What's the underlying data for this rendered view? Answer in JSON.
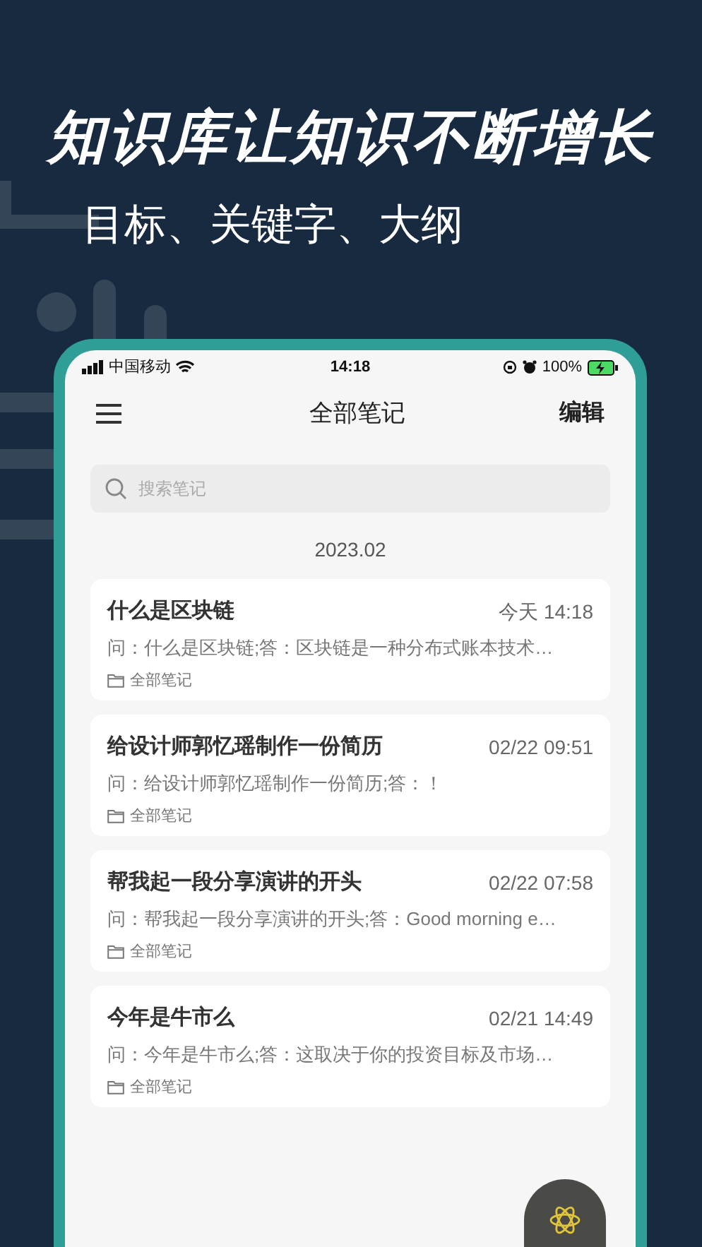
{
  "promo": {
    "headline": "知识库让知识不断增长",
    "subtitle": "目标、关键字、大纲"
  },
  "status_bar": {
    "carrier": "中国移动",
    "time": "14:18",
    "battery": "100%"
  },
  "nav": {
    "title": "全部笔记",
    "action": "编辑"
  },
  "search": {
    "placeholder": "搜索笔记"
  },
  "section_date": "2023.02",
  "notes": [
    {
      "title": "什么是区块链",
      "time": "今天 14:18",
      "preview": "问：什么是区块链;答：区块链是一种分布式账本技术…",
      "folder": "全部笔记"
    },
    {
      "title": "给设计师郭忆瑶制作一份简历",
      "time": "02/22 09:51",
      "preview": "问：给设计师郭忆瑶制作一份简历;答：！",
      "folder": "全部笔记"
    },
    {
      "title": "帮我起一段分享演讲的开头",
      "time": "02/22 07:58",
      "preview": "问：帮我起一段分享演讲的开头;答：Good morning e…",
      "folder": "全部笔记"
    },
    {
      "title": "今年是牛市么",
      "time": "02/21 14:49",
      "preview": "问：今年是牛市么;答：这取决于你的投资目标及市场…",
      "folder": "全部笔记"
    }
  ]
}
